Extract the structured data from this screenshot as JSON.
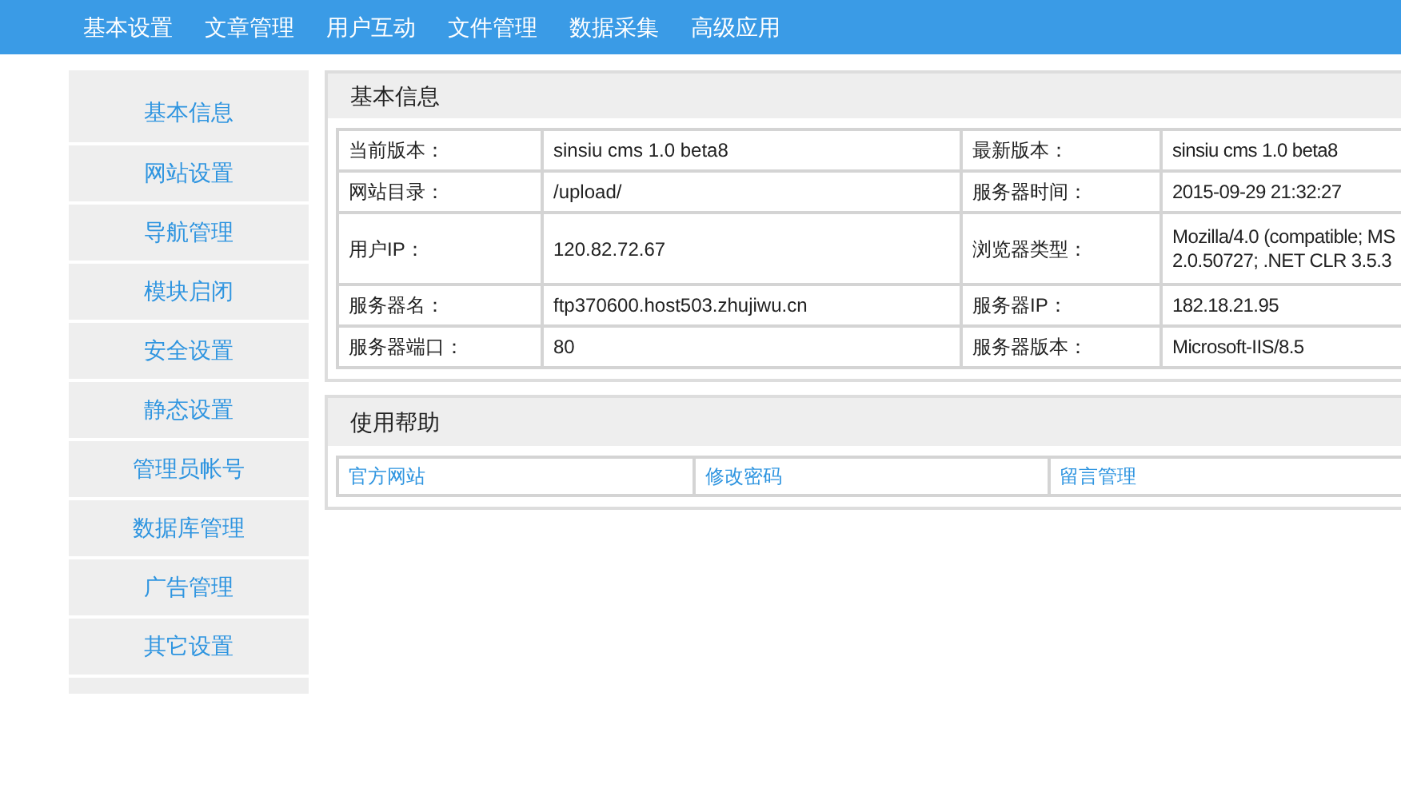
{
  "nav": [
    "基本设置",
    "文章管理",
    "用户互动",
    "文件管理",
    "数据采集",
    "高级应用"
  ],
  "sidebar": {
    "items": [
      "基本信息",
      "网站设置",
      "导航管理",
      "模块启闭",
      "安全设置",
      "静态设置",
      "管理员帐号",
      "数据库管理",
      "广告管理",
      "其它设置"
    ]
  },
  "info_panel": {
    "title": "基本信息",
    "rows": [
      {
        "label_1": "当前版本：",
        "value_1": [
          "sinsiu cms 1.0 beta8"
        ],
        "label_2": "最新版本：",
        "value_2": [
          "sinsiu cms 1.0 beta8"
        ]
      },
      {
        "label_1": "网站目录：",
        "value_1": [
          "/upload/"
        ],
        "label_2": "服务器时间：",
        "value_2": [
          "2015-09-29 21:32:27"
        ]
      },
      {
        "label_1": "用户IP：",
        "value_1": [
          "120.82.72.67"
        ],
        "label_2": "浏览器类型：",
        "value_2": [
          "Mozilla/4.0 (compatible; MS",
          "2.0.50727; .NET CLR 3.5.3"
        ]
      },
      {
        "label_1": "服务器名：",
        "value_1": [
          "ftp370600.host503.zhujiwu.cn"
        ],
        "label_2": "服务器IP：",
        "value_2": [
          "182.18.21.95"
        ]
      },
      {
        "label_1": "服务器端口：",
        "value_1": [
          "80"
        ],
        "label_2": "服务器版本：",
        "value_2": [
          "Microsoft-IIS/8.5"
        ]
      }
    ]
  },
  "help_panel": {
    "title": "使用帮助",
    "links": [
      "官方网站",
      "修改密码",
      "留言管理"
    ]
  }
}
